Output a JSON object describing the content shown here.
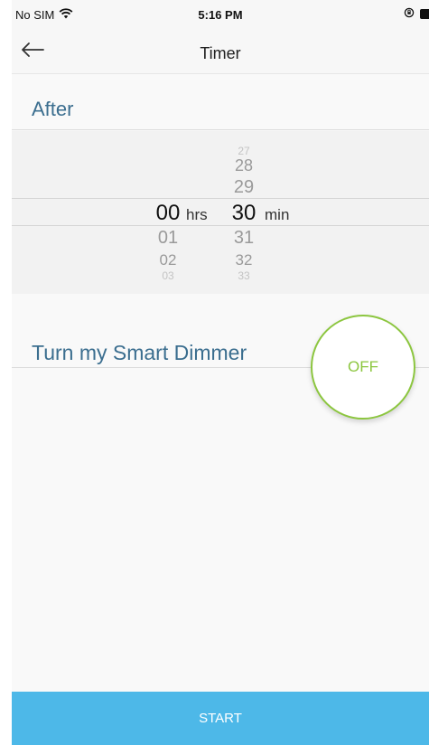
{
  "status_bar": {
    "carrier": "No SIM",
    "time": "5:16 PM"
  },
  "nav": {
    "title": "Timer"
  },
  "after_section": {
    "label": "After"
  },
  "picker": {
    "hours": {
      "above": [],
      "selected": "00",
      "below": [
        "01",
        "02",
        "03"
      ],
      "unit": "hrs"
    },
    "minutes": {
      "above": [
        "27",
        "28",
        "29"
      ],
      "selected": "30",
      "below": [
        "31",
        "32",
        "33"
      ],
      "unit": "min"
    }
  },
  "dimmer_section": {
    "label": "Turn my Smart Dimmer",
    "toggle_state": "OFF"
  },
  "footer": {
    "start_label": "START"
  },
  "colors": {
    "accent_blue": "#4db8e8",
    "toggle_green": "#8cc63f",
    "section_label": "#3b6e8f"
  },
  "icons": {
    "wifi": "wifi-icon",
    "back": "back-arrow-icon",
    "orientation_lock": "orientation-lock-icon",
    "battery": "battery-icon"
  }
}
